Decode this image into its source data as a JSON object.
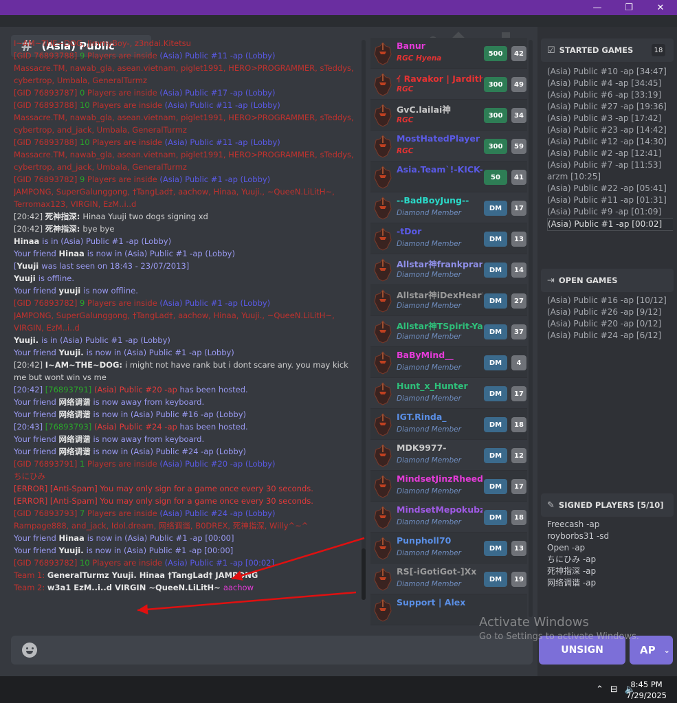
{
  "window": {
    "minimize": "—",
    "maximize": "❐",
    "close": "✕"
  },
  "channel": {
    "name": "(Asia) Public"
  },
  "messages": [
    [
      [
        "t-dred",
        "I~AM~THE~DOG, JimmyBoy-, z3ndai.Kitetsu"
      ]
    ],
    [
      [
        "t-dred",
        "[GID 76893788] "
      ],
      [
        "t-green",
        "9 "
      ],
      [
        "t-dred",
        "Players are inside "
      ],
      [
        "t-blue",
        "(Asia) Public #11 -ap (Lobby)"
      ]
    ],
    [
      [
        "t-dred",
        "Massacre.TM, nawab_gla, asean.vietnam, piglet1991, HERO>PROGRAMMER, sTeddys, cybertrop, Umbala, GeneralTurmz"
      ]
    ],
    [
      [
        "t-dred",
        "[GID 76893787] "
      ],
      [
        "t-green",
        "0 "
      ],
      [
        "t-dred",
        "Players are inside "
      ],
      [
        "t-blue",
        "(Asia) Public #17 -ap (Lobby)"
      ]
    ],
    [
      [
        "t-dred",
        "[GID 76893788] "
      ],
      [
        "t-green",
        "10 "
      ],
      [
        "t-dred",
        "Players are inside "
      ],
      [
        "t-blue",
        "(Asia) Public #11 -ap (Lobby)"
      ]
    ],
    [
      [
        "t-dred",
        "Massacre.TM, nawab_gla, asean.vietnam, piglet1991, HERO>PROGRAMMER, sTeddys, cybertrop, and_jack, Umbala, GeneralTurmz"
      ]
    ],
    [
      [
        "t-dred",
        "[GID 76893788] "
      ],
      [
        "t-green",
        "10 "
      ],
      [
        "t-dred",
        "Players are inside "
      ],
      [
        "t-blue",
        "(Asia) Public #11 -ap (Lobby)"
      ]
    ],
    [
      [
        "t-dred",
        "Massacre.TM, nawab_gla, asean.vietnam, piglet1991, HERO>PROGRAMMER, sTeddys, cybertrop, and_jack, Umbala, GeneralTurmz"
      ]
    ],
    [
      [
        "t-dred",
        "[GID 76893782] "
      ],
      [
        "t-green",
        "9 "
      ],
      [
        "t-dred",
        "Players are inside "
      ],
      [
        "t-blue",
        "(Asia) Public #1 -ap (Lobby)"
      ]
    ],
    [
      [
        "t-dred",
        "JAMPONG, SuperGalunggong, †TangLad†, aachow, Hinaa, Yuuji., ~QueeN.LiLitH~, Terromax123, VIRGIN, EzM..i..d"
      ]
    ],
    [
      [
        "t-grey",
        "[20:42] "
      ],
      [
        "t-white",
        "死神指深: "
      ],
      [
        "t-grey",
        "Hinaa Yuuji two dogs signing xd"
      ]
    ],
    [
      [
        "t-grey",
        "[20:42] "
      ],
      [
        "t-white",
        "死神指深: "
      ],
      [
        "t-grey",
        "bye bye"
      ]
    ],
    [
      [
        "t-white",
        "Hinaa "
      ],
      [
        "t-lav",
        "is in (Asia) Public #1 -ap (Lobby)"
      ]
    ],
    [
      [
        "t-lav",
        "Your friend "
      ],
      [
        "t-white",
        "Hinaa "
      ],
      [
        "t-lav",
        "is now in (Asia) Public #1 -ap (Lobby)"
      ]
    ],
    [
      [
        "t-lav",
        "["
      ],
      [
        "t-white",
        "Yuuji "
      ],
      [
        "t-lav",
        "was last seen on 18:43 - 23/07/2013]"
      ]
    ],
    [
      [
        "t-white",
        "Yuuji "
      ],
      [
        "t-lav",
        "is offline."
      ]
    ],
    [
      [
        "t-lav",
        "Your friend "
      ],
      [
        "t-white",
        "yuuji "
      ],
      [
        "t-lav",
        "is now offline."
      ]
    ],
    [
      [
        "t-dred",
        "[GID 76893782] "
      ],
      [
        "t-green",
        "9 "
      ],
      [
        "t-dred",
        "Players are inside "
      ],
      [
        "t-blue",
        "(Asia) Public #1 -ap (Lobby)"
      ]
    ],
    [
      [
        "t-dred",
        "JAMPONG, SuperGalunggong, †TangLad†, aachow, Hinaa, Yuuji., ~QueeN.LiLitH~, VIRGIN, EzM..i..d"
      ]
    ],
    [
      [
        "t-white",
        "Yuuji. "
      ],
      [
        "t-lav",
        "is in (Asia) Public #1 -ap (Lobby)"
      ]
    ],
    [
      [
        "t-lav",
        "Your friend "
      ],
      [
        "t-white",
        "Yuuji. "
      ],
      [
        "t-lav",
        "is now in (Asia) Public #1 -ap (Lobby)"
      ]
    ],
    [
      [
        "t-grey",
        "[20:42] "
      ],
      [
        "t-white",
        "I~AM~THE~DOG: "
      ],
      [
        "t-grey",
        "i might not have rank but i dont scare any. you may kick me but wont win vs me"
      ]
    ],
    [
      [
        "t-lav",
        "[20:42] "
      ],
      [
        "t-green",
        "[76893791] "
      ],
      [
        "t-red",
        "(Asia) Public #20 -ap "
      ],
      [
        "t-lav",
        "has been hosted."
      ]
    ],
    [
      [
        "t-lav",
        "Your friend "
      ],
      [
        "t-white",
        "网络调谐 "
      ],
      [
        "t-lav",
        "is now away from keyboard."
      ]
    ],
    [
      [
        "t-lav",
        "Your friend "
      ],
      [
        "t-white",
        "网络调谐 "
      ],
      [
        "t-lav",
        "is now in (Asia) Public #16 -ap (Lobby)"
      ]
    ],
    [
      [
        "t-lav",
        "[20:43] "
      ],
      [
        "t-green",
        "[76893793] "
      ],
      [
        "t-red",
        "(Asia) Public #24 -ap "
      ],
      [
        "t-lav",
        "has been hosted."
      ]
    ],
    [
      [
        "t-lav",
        "Your friend "
      ],
      [
        "t-white",
        "网络调谐 "
      ],
      [
        "t-lav",
        "is now away from keyboard."
      ]
    ],
    [
      [
        "t-lav",
        "Your friend "
      ],
      [
        "t-white",
        "网络调谐 "
      ],
      [
        "t-lav",
        "is now in (Asia) Public #24 -ap (Lobby)"
      ]
    ],
    [
      [
        "t-dred",
        "[GID 76893791] "
      ],
      [
        "t-green",
        "1 "
      ],
      [
        "t-dred",
        "Players are inside "
      ],
      [
        "t-blue",
        "(Asia) Public #20 -ap (Lobby)"
      ]
    ],
    [
      [
        "t-dred",
        "ちにひみ"
      ]
    ],
    [
      [
        "t-red",
        "[ERROR] [Anti-Spam] You may only sign for a game once every 30 seconds."
      ]
    ],
    [
      [
        "t-red",
        "[ERROR] [Anti-Spam] You may only sign for a game once every 30 seconds."
      ]
    ],
    [
      [
        "t-dred",
        "[GID 76893793] "
      ],
      [
        "t-green",
        "7 "
      ],
      [
        "t-dred",
        "Players are inside "
      ],
      [
        "t-blue",
        "(Asia) Public #24 -ap (Lobby)"
      ]
    ],
    [
      [
        "t-dred",
        "Rampage888, and_jack, Idol.dream, 网络调谐, B0DREX, 死神指深, Willy^~^"
      ]
    ],
    [
      [
        "t-lav",
        "Your friend "
      ],
      [
        "t-white",
        "Hinaa "
      ],
      [
        "t-lav",
        "is now in (Asia) Public #1 -ap [00:00]"
      ]
    ],
    [
      [
        "t-lav",
        "Your friend "
      ],
      [
        "t-white",
        "Yuuji. "
      ],
      [
        "t-lav",
        "is now in (Asia) Public #1 -ap [00:00]"
      ]
    ],
    [
      [
        "t-dred",
        "[GID 76893782] "
      ],
      [
        "t-green",
        "10 "
      ],
      [
        "t-dred",
        "Players are inside "
      ],
      [
        "t-blue",
        "(Asia) Public #1 -ap [00:02]"
      ]
    ],
    [
      [
        "t-dred",
        "Team 1:    "
      ],
      [
        "t-team",
        "GeneralTurmz    Yuuji.    Hinaa    †TangLad†    JAMPONG"
      ]
    ],
    [
      [
        "t-dred",
        "Team 2:    "
      ],
      [
        "t-team",
        "w3a1    EzM..i..d    VIRGIN    ~QueeN.LiLitH~    "
      ],
      [
        "t-pink",
        "aachow"
      ]
    ]
  ],
  "players": [
    {
      "name": "Banur",
      "name_color": "#e43bd8",
      "sub": "RGC Hyena",
      "sub_type": "rgc",
      "rank": "500",
      "rank_type": "green",
      "level": "42"
    },
    {
      "name": "ｲ Ravakor | Jardith ✝",
      "name_color": "#e53232",
      "sub": "RGC",
      "sub_type": "rgc",
      "rank": "300",
      "rank_type": "green",
      "level": "49"
    },
    {
      "name": "GvC.lailai神",
      "name_color": "#c9c9c9",
      "sub": "RGC",
      "sub_type": "rgc",
      "rank": "300",
      "rank_type": "green",
      "level": "34"
    },
    {
      "name": "MostHatedPlayer",
      "name_color": "#5a5ae6",
      "sub": "RGC",
      "sub_type": "rgc",
      "rank": "300",
      "rank_type": "green",
      "level": "59"
    },
    {
      "name": "Asia.Team`!-KICK-!",
      "name_color": "#5a5ae6",
      "sub": "",
      "sub_type": "dm",
      "rank": "50",
      "rank_type": "green",
      "level": "41"
    },
    {
      "name": "--BadBoyJung--",
      "name_color": "#2ad9c8",
      "sub": "Diamond Member",
      "sub_type": "dm",
      "rank": "DM",
      "rank_type": "dm",
      "level": "17"
    },
    {
      "name": "-tDor",
      "name_color": "#5a5ae6",
      "sub": "Diamond Member",
      "sub_type": "dm",
      "rank": "DM",
      "rank_type": "dm",
      "level": "13"
    },
    {
      "name": "Allstar神frankpranb",
      "name_color": "#8f8fe8",
      "sub": "Diamond Member",
      "sub_type": "dm",
      "rank": "DM",
      "rank_type": "dm",
      "level": "14"
    },
    {
      "name": "Allstar神iDexHear'",
      "name_color": "#9a9a9a",
      "sub": "Diamond Member",
      "sub_type": "dm",
      "rank": "DM",
      "rank_type": "dm",
      "level": "27"
    },
    {
      "name": "Allstar神TSpirit-Yato",
      "name_color": "#2ec07a",
      "sub": "Diamond Member",
      "sub_type": "dm",
      "rank": "DM",
      "rank_type": "dm",
      "level": "37"
    },
    {
      "name": "BaByMind__",
      "name_color": "#e43bd8",
      "sub": "Diamond Member",
      "sub_type": "dm",
      "rank": "DM",
      "rank_type": "dm",
      "level": "4"
    },
    {
      "name": "Hunt_x_Hunter",
      "name_color": "#2ec07a",
      "sub": "Diamond Member",
      "sub_type": "dm",
      "rank": "DM",
      "rank_type": "dm",
      "level": "17"
    },
    {
      "name": "IGT.Rinda_",
      "name_color": "#5a8fe6",
      "sub": "Diamond Member",
      "sub_type": "dm",
      "rank": "DM",
      "rank_type": "dm",
      "level": "18"
    },
    {
      "name": "MDK9977-",
      "name_color": "#c9c9c9",
      "sub": "Diamond Member",
      "sub_type": "dm",
      "rank": "DM",
      "rank_type": "dm",
      "level": "12"
    },
    {
      "name": "MindsetJinzRheed-",
      "name_color": "#e43bd8",
      "sub": "Diamond Member",
      "sub_type": "dm",
      "rank": "DM",
      "rank_type": "dm",
      "level": "17"
    },
    {
      "name": "MindsetMepokubz",
      "name_color": "#a05ae6",
      "sub": "Diamond Member",
      "sub_type": "dm",
      "rank": "DM",
      "rank_type": "dm",
      "level": "18"
    },
    {
      "name": "Punpholl70",
      "name_color": "#5a8fe6",
      "sub": "Diamond Member",
      "sub_type": "dm",
      "rank": "DM",
      "rank_type": "dm",
      "level": "13"
    },
    {
      "name": "RS[-iGotiGot-]Xx",
      "name_color": "#9a9a9a",
      "sub": "Diamond Member",
      "sub_type": "dm",
      "rank": "DM",
      "rank_type": "dm",
      "level": "19"
    },
    {
      "name": "Support | Alex",
      "name_color": "#5a8fe6",
      "sub": "",
      "sub_type": "dm",
      "rank": "",
      "rank_type": "dm",
      "level": ""
    }
  ],
  "started_games": {
    "title": "STARTED GAMES",
    "badge": "18",
    "items": [
      "(Asia) Public #10 -ap [34:47]",
      "(Asia) Public #4 -ap [34:45]",
      "(Asia) Public #6 -ap [33:19]",
      "(Asia) Public #27 -ap [19:36]",
      "(Asia) Public #3 -ap [17:42]",
      "(Asia) Public #23 -ap [14:42]",
      "(Asia) Public #12 -ap [14:30]",
      "(Asia) Public #2 -ap [12:41]",
      "(Asia) Public #7 -ap [11:53]",
      "arzm [10:25]",
      "(Asia) Public #22 -ap [05:41]",
      "(Asia) Public #11 -ap [01:31]",
      "(Asia) Public #9 -ap [01:09]",
      "(Asia) Public #1 -ap [00:02]"
    ],
    "selected_index": 13
  },
  "open_games": {
    "title": "OPEN GAMES",
    "items": [
      "(Asia) Public #16 -ap [10/12]",
      "(Asia) Public #26 -ap [9/12]",
      "(Asia) Public #20 -ap [0/12]",
      "(Asia) Public #24 -ap [6/12]"
    ]
  },
  "signed_players": {
    "title": "SIGNED PLAYERS [5/10]",
    "items": [
      "Freecash -ap",
      "royborbs31 -sd",
      "Open -ap",
      "ちにひみ -ap",
      "死神指深 -ap",
      "网络调谐 -ap"
    ]
  },
  "input": {
    "placeholder": ""
  },
  "buttons": {
    "unsign": "UNSIGN",
    "mode": "AP"
  },
  "watermark": {
    "line1": "Activate Windows",
    "line2": "Go to Settings to activate Windows."
  },
  "taskbar": {
    "time": "8:45 PM",
    "date": "7/29/2025"
  }
}
